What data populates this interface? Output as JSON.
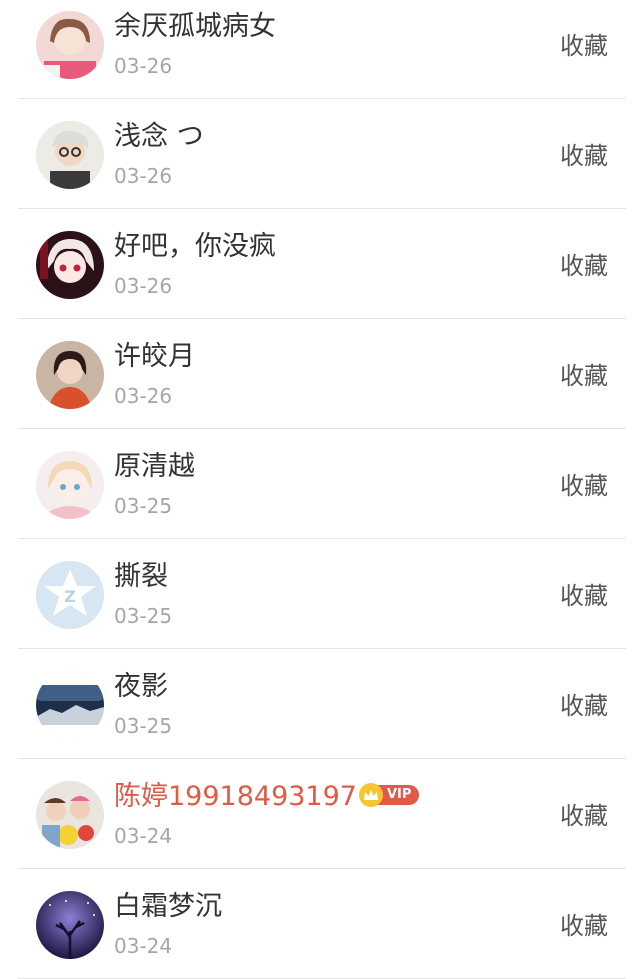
{
  "list": [
    {
      "name": "余厌孤城病女",
      "date": "03-26",
      "action": "收藏",
      "avatar": "girl-portrait-avatar",
      "vip": false
    },
    {
      "name": "浅念 つ",
      "date": "03-26",
      "action": "收藏",
      "avatar": "boy-portrait-avatar",
      "vip": false
    },
    {
      "name": "好吧，你没疯",
      "date": "03-26",
      "action": "收藏",
      "avatar": "anime-girl-avatar",
      "vip": false
    },
    {
      "name": "许皎月",
      "date": "03-26",
      "action": "收藏",
      "avatar": "woman-portrait-avatar",
      "vip": false
    },
    {
      "name": "原清越",
      "date": "03-25",
      "action": "收藏",
      "avatar": "cartoon-girl-avatar",
      "vip": false
    },
    {
      "name": "撕裂",
      "date": "03-25",
      "action": "收藏",
      "avatar": "default-qzone-avatar",
      "vip": false
    },
    {
      "name": "夜影",
      "date": "03-25",
      "action": "收藏",
      "avatar": "landscape-avatar",
      "vip": false
    },
    {
      "name": "陈婷19918493197",
      "date": "03-24",
      "action": "收藏",
      "avatar": "family-photo-avatar",
      "vip": true,
      "vip_label": "VIP"
    },
    {
      "name": "白霜梦沉",
      "date": "03-24",
      "action": "收藏",
      "avatar": "starry-tree-avatar",
      "vip": false
    }
  ],
  "colors": {
    "name": "#333333",
    "vip_name": "#e05a45",
    "date": "#a6a6a6",
    "divider": "#e4e4e4",
    "vip_badge": "#e05a45",
    "crown": "#f7c531"
  }
}
